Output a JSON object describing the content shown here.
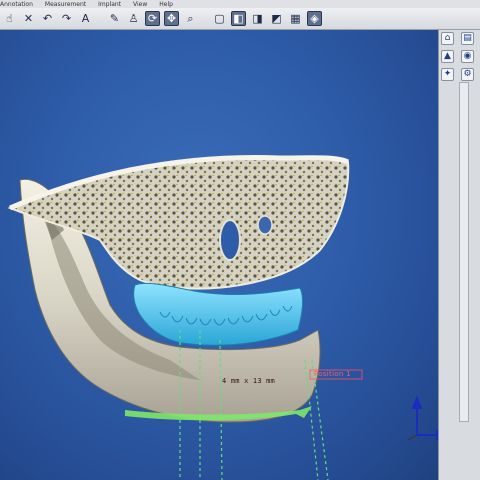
{
  "menu": {
    "items": [
      "Annotation",
      "Measurement",
      "Implant",
      "View",
      "Help"
    ]
  },
  "toolbar": {
    "buttons": [
      {
        "icon": "hand-select-icon",
        "glyph": "☝"
      },
      {
        "icon": "delete-icon",
        "glyph": "✕"
      },
      {
        "icon": "undo-icon",
        "glyph": "↶"
      },
      {
        "icon": "redo-icon",
        "glyph": "↷"
      },
      {
        "icon": "text-icon",
        "glyph": "A"
      },
      {
        "icon": "note-icon",
        "glyph": "✎"
      },
      {
        "icon": "tooth-icon",
        "glyph": "♙"
      },
      {
        "icon": "rotate-icon",
        "glyph": "⟳"
      },
      {
        "icon": "pan-icon",
        "glyph": "✥"
      },
      {
        "icon": "zoom-icon",
        "glyph": "⌕"
      },
      {
        "icon": "window-icon",
        "glyph": "▢"
      },
      {
        "icon": "view-front-icon",
        "glyph": "◧"
      },
      {
        "icon": "view-side-icon",
        "glyph": "◨"
      },
      {
        "icon": "view-top-icon",
        "glyph": "◩"
      },
      {
        "icon": "grid-icon",
        "glyph": "▦"
      },
      {
        "icon": "render-icon",
        "glyph": "◈"
      }
    ]
  },
  "viewport": {
    "measurement_label": "4 mm x 13 mm",
    "red_label": "Position 1"
  },
  "colors": {
    "viewport_bg": "#2e5ca8",
    "bone": "#e8e6dc",
    "guide": "#57c8e8",
    "measure_line": "#7ee86a"
  }
}
